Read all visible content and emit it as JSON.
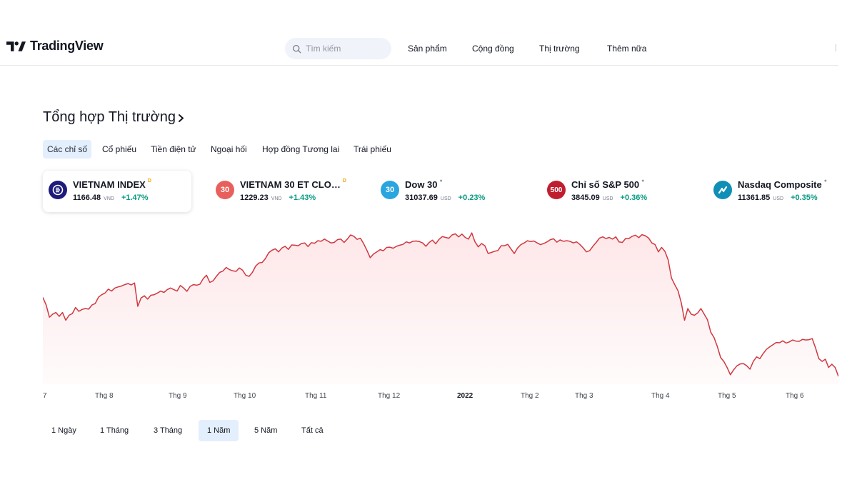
{
  "header": {
    "brand": "TradingView",
    "search": {
      "placeholder": "Tìm kiếm",
      "value": ""
    },
    "nav": [
      "Sản phẩm",
      "Cộng đồng",
      "Thị trường",
      "Thêm nữa"
    ]
  },
  "section": {
    "title": "Tổng hợp Thị trường",
    "tabs": [
      "Các chỉ số",
      "Cổ phiếu",
      "Tiền điện tử",
      "Ngoại hối",
      "Hợp đồng Tương lai",
      "Trái phiếu"
    ],
    "active_tab": "Các chỉ số"
  },
  "indices": [
    {
      "name": "VIETNAM INDEX",
      "logo": "",
      "logo_color": "#1e1b7a",
      "mark": "D",
      "mark_color": "#f0a500",
      "price": "1166.48",
      "currency": "VND",
      "change": "+1.47%",
      "active": true
    },
    {
      "name": "VIETNAM 30 ET CLO…",
      "logo": "30",
      "logo_color": "#e8605b",
      "mark": "D",
      "mark_color": "#f0a500",
      "price": "1229.23",
      "currency": "VND",
      "change": "+1.43%",
      "active": false
    },
    {
      "name": "Dow 30",
      "logo": "30",
      "logo_color": "#2aa6df",
      "mark": "●",
      "mark_color": "#9598a1",
      "price": "31037.69",
      "currency": "USD",
      "change": "+0.23%",
      "active": false
    },
    {
      "name": "Chỉ số S&P 500",
      "logo": "500",
      "logo_color": "#c01e2e",
      "mark": "●",
      "mark_color": "#9598a1",
      "price": "3845.09",
      "currency": "USD",
      "change": "+0.36%",
      "active": false
    },
    {
      "name": "Nasdaq Composite",
      "logo": "",
      "logo_color": "#0f8fb5",
      "mark": "●",
      "mark_color": "#9598a1",
      "price": "11361.85",
      "currency": "USD",
      "change": "+0.35%",
      "active": false
    }
  ],
  "chart_data": {
    "type": "area",
    "series": [
      {
        "values": [
          1312,
          1285,
          1241,
          1252,
          1258,
          1244,
          1258,
          1230,
          1248,
          1254,
          1276,
          1262,
          1269,
          1272,
          1270,
          1285,
          1290,
          1313,
          1322,
          1328,
          1342,
          1335,
          1346,
          1350,
          1353,
          1358,
          1362,
          1357,
          1364,
          1280,
          1310,
          1318,
          1306,
          1320,
          1322,
          1328,
          1335,
          1330,
          1340,
          1346,
          1340,
          1335,
          1355,
          1346,
          1334,
          1352,
          1358,
          1356,
          1360,
          1380,
          1392,
          1366,
          1372,
          1388,
          1402,
          1407,
          1420,
          1412,
          1408,
          1406,
          1418,
          1410,
          1392,
          1388,
          1402,
          1425,
          1436,
          1438,
          1452,
          1473,
          1482,
          1487,
          1476,
          1490,
          1496,
          1485,
          1501,
          1500,
          1498,
          1506,
          1508,
          1495,
          1509,
          1507,
          1516,
          1514,
          1522,
          1515,
          1508,
          1510,
          1520,
          1522,
          1510,
          1522,
          1537,
          1532,
          1521,
          1525,
          1505,
          1481,
          1455,
          1468,
          1476,
          1484,
          1480,
          1492,
          1493,
          1489,
          1496,
          1500,
          1503,
          1512,
          1508,
          1514,
          1515,
          1513,
          1508,
          1496,
          1510,
          1518,
          1505,
          1521,
          1531,
          1528,
          1525,
          1537,
          1541,
          1530,
          1540,
          1528,
          1522,
          1544,
          1512,
          1494,
          1506,
          1498,
          1470,
          1474,
          1478,
          1481,
          1498,
          1498,
          1503,
          1486,
          1470,
          1490,
          1502,
          1508,
          1516,
          1513,
          1515,
          1508,
          1502,
          1506,
          1512,
          1520,
          1523,
          1511,
          1519,
          1514,
          1516,
          1514,
          1508,
          1512,
          1503,
          1491,
          1476,
          1480,
          1496,
          1510,
          1525,
          1530,
          1524,
          1528,
          1522,
          1530,
          1512,
          1510,
          1524,
          1524,
          1532,
          1536,
          1527,
          1538,
          1534,
          1526,
          1508,
          1502,
          1476,
          1492,
          1478,
          1447,
          1382,
          1358,
          1336,
          1292,
          1230,
          1272,
          1252,
          1248,
          1256,
          1272,
          1252,
          1232,
          1187,
          1168,
          1136,
          1096,
          1082,
          1060,
          1034,
          1052,
          1066,
          1073,
          1074,
          1066,
          1054,
          1082,
          1098,
          1092,
          1110,
          1125,
          1134,
          1142,
          1150,
          1149,
          1156,
          1148,
          1152,
          1159,
          1155,
          1154,
          1161,
          1159,
          1160,
          1164,
          1131,
          1092,
          1082,
          1090,
          1060,
          1072,
          1060,
          1028
        ]
      }
    ],
    "ylim": [
      1000,
      1560
    ],
    "x_ticks": [
      "7",
      "Thg 8",
      "Thg 9",
      "Thg 10",
      "Thg 11",
      "Thg 12",
      "2022",
      "Thg 2",
      "Thg 3",
      "Thg 4",
      "Thg 5",
      "Thg 6"
    ],
    "grid": false,
    "line_color": "#d0383f",
    "fill_color": "#f23645"
  },
  "ranges": [
    "1 Ngày",
    "1 Tháng",
    "3 Tháng",
    "1 Năm",
    "5 Năm",
    "Tất cả"
  ],
  "active_range": "1 Năm"
}
